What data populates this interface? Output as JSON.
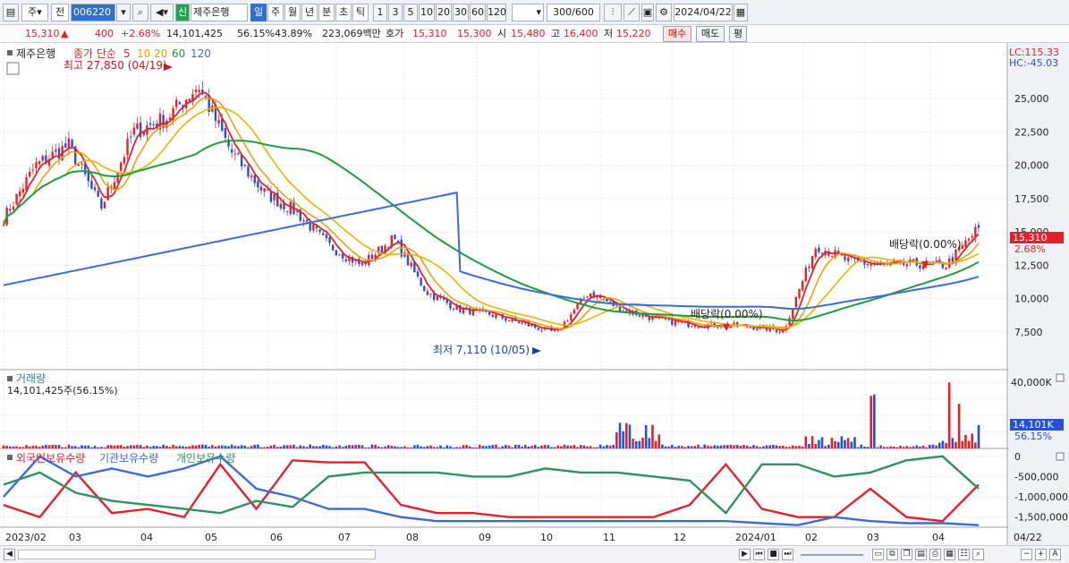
{
  "toolbar": {
    "type_select": "주",
    "scope_select": "전",
    "code": "006220",
    "credit_badge": "신",
    "stock_name": "제주은행",
    "periods": [
      "일",
      "주",
      "월",
      "년",
      "분",
      "초",
      "틱"
    ],
    "active_period": "일",
    "intervals": [
      "1",
      "3",
      "5",
      "10",
      "20",
      "30",
      "60",
      "120"
    ],
    "count": "300",
    "count_max": "/600",
    "date": "2024/04/22"
  },
  "quote": {
    "price": "15,310",
    "change_arrow": "▲",
    "change": "400",
    "change_pct": "+2.68%",
    "volume": "14,101,425",
    "turnover_pct": "56.15%",
    "foreign_pct": "43.89%",
    "amount": "223,069백만",
    "hoga_label": "호가",
    "ask": "15,310",
    "bid": "15,300",
    "open_label": "시",
    "open": "15,480",
    "high_label": "고",
    "high": "16,400",
    "low_label": "저",
    "low": "15,220",
    "buy_btn": "매수",
    "sell_btn": "매도",
    "eval_btn": "평"
  },
  "price_panel": {
    "stock_label": "제주은행",
    "ma_label": "종가 단순",
    "ma_periods": [
      "5",
      "10",
      "20",
      "60",
      "120"
    ],
    "lc": "LC:115.33",
    "hc": "HC:-45.03",
    "current_price_tag": "15,310",
    "current_pct_tag": "2.68%",
    "high_annotation": "최고 27,850 (04/19)",
    "low_annotation": "최저 7,110 (10/05)",
    "dividend_annotation_1": "배당락(0.00%)",
    "dividend_annotation_2": "배당락(0.00%)"
  },
  "volume_panel": {
    "title": "거래량",
    "subtitle": "14,101,425주(56.15%)",
    "current_tag": "14,101K",
    "current_pct": "56.15%"
  },
  "holding_panel": {
    "legend": [
      "외국인보유수량",
      "기관보유수량",
      "개인보유수량"
    ]
  },
  "x_axis_labels": [
    "2023/02",
    "03",
    "04",
    "05",
    "06",
    "07",
    "08",
    "09",
    "10",
    "11",
    "12",
    "2024/01",
    "02",
    "03",
    "04"
  ],
  "x_axis_right_label": "04/22",
  "colors": {
    "up": "#e4212b",
    "down": "#2450d6",
    "ma5": "#e4212b",
    "ma10": "#f2a007",
    "ma20": "#e8b400",
    "ma60": "#1e9c3e",
    "ma120": "#3b6bd6",
    "foreign": "#e4212b",
    "institution": "#3b6bd6",
    "individual": "#2e9160"
  },
  "chart_data": {
    "type": "line",
    "title": "",
    "price": {
      "ylim": [
        5000,
        28500
      ],
      "y_ticks": [
        7500,
        10000,
        12500,
        15000,
        17500,
        20000,
        22500,
        25000
      ],
      "close_series": {
        "x": [
          "2023/02",
          "2023/02 mid",
          "2023/03",
          "2023/03 mid",
          "2023/04",
          "2023/04 mid",
          "2023/04/19",
          "2023/05",
          "2023/05 mid",
          "2023/06",
          "2023/06 mid",
          "2023/07",
          "2023/07 mid",
          "2023/08",
          "2023/08 mid",
          "2023/09",
          "2023/09 mid",
          "2023/10/05",
          "2023/10 mid",
          "2023/11",
          "2023/11 mid",
          "2023/12",
          "2023/12 mid",
          "2024/01",
          "2024/01 end",
          "2024/02",
          "2024/02 mid",
          "2024/03",
          "2024/03 mid",
          "2024/04",
          "2024/04/22"
        ],
        "values": [
          16000,
          20000,
          21500,
          16800,
          22500,
          23500,
          26000,
          21000,
          18000,
          16500,
          14000,
          12500,
          14500,
          10500,
          9200,
          8800,
          8100,
          7400,
          10500,
          9200,
          8500,
          8100,
          8000,
          7900,
          7600,
          14000,
          12800,
          12500,
          12600,
          12500,
          15310
        ]
      },
      "ma60_end": 12400,
      "ma120_end": 10300
    },
    "volume": {
      "ylim": [
        0,
        45000
      ],
      "y_ticks": [
        10000,
        20000,
        30000,
        40000
      ],
      "y_tick_labels": [
        "",
        "",
        "",
        "40,000K"
      ]
    },
    "holdings": {
      "ylim": [
        -1750000,
        150000
      ],
      "y_ticks": [
        0,
        -500000,
        -1000000,
        -1500000
      ],
      "y_tick_labels": [
        "0",
        "-500,000",
        "-1,000,000",
        "-1,500,000"
      ]
    }
  }
}
